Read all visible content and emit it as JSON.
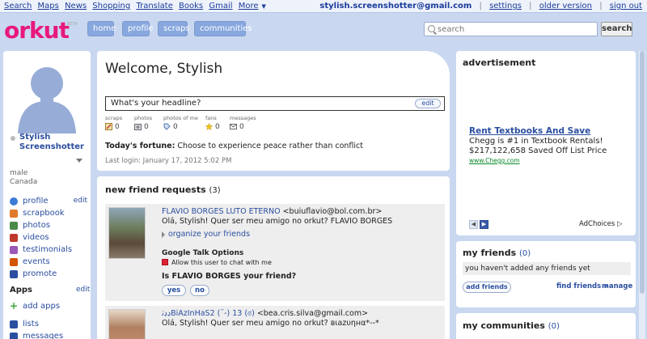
{
  "gbar": {
    "links": [
      "Search",
      "Maps",
      "News",
      "Shopping",
      "Translate",
      "Books",
      "Gmail",
      "More"
    ],
    "user": "stylish.screenshotter@gmail.com",
    "settings": "settings",
    "older_version": "older version",
    "sign_out": "sign out"
  },
  "header": {
    "logo": "orkut",
    "logo_sub": "BETA",
    "nav": [
      "home",
      "profile",
      "scraps",
      "communities"
    ],
    "search_placeholder": "search",
    "search_button": "search"
  },
  "profile": {
    "name_line1": "Stylish",
    "name_line2": "Screenshotter",
    "gender": "male",
    "country": "Canada",
    "edit": "edit",
    "menu": [
      {
        "label": "profile",
        "icon": "person-icon",
        "color": "#3a7bd5"
      },
      {
        "label": "scrapbook",
        "icon": "scrapbook-icon",
        "color": "#e07a2a"
      },
      {
        "label": "photos",
        "icon": "photos-icon",
        "color": "#4a8a4a"
      },
      {
        "label": "videos",
        "icon": "videos-icon",
        "color": "#c0392b"
      },
      {
        "label": "testimonials",
        "icon": "testimonials-icon",
        "color": "#9b59b6"
      },
      {
        "label": "events",
        "icon": "events-icon",
        "color": "#d35400"
      },
      {
        "label": "promote",
        "icon": "promote-icon",
        "color": "#2a4ea0"
      }
    ],
    "apps_heading": "Apps",
    "apps_edit": "edit",
    "apps_menu": [
      {
        "label": "add apps",
        "icon": "plus-icon",
        "color": "#3aa53a"
      }
    ],
    "extra_menu": [
      {
        "label": "lists",
        "icon": "lists-icon",
        "color": "#2a4ea0"
      },
      {
        "label": "messages",
        "icon": "messages-icon",
        "color": "#2a4ea0"
      }
    ]
  },
  "welcome": {
    "title": "Welcome, Stylish",
    "headline_placeholder": "What's your headline?",
    "edit": "edit",
    "stats": [
      {
        "label": "scraps",
        "value": "0",
        "icon": "scraps-icon"
      },
      {
        "label": "photos",
        "value": "0",
        "icon": "photos-icon"
      },
      {
        "label": "photos of me",
        "value": "0",
        "icon": "tag-icon"
      },
      {
        "label": "fans",
        "value": "0",
        "icon": "star-icon"
      },
      {
        "label": "messages",
        "value": "0",
        "icon": "envelope-icon"
      }
    ],
    "fortune_label": "Today's fortune:",
    "fortune_text": " Choose to experience peace rather than conflict",
    "last_login": "Last login: January 17, 2012 5:02 PM"
  },
  "friend_requests": {
    "heading": "new friend requests",
    "count": "(3)",
    "items": [
      {
        "name": "FLAVIO BORGES LUTO ETERNO",
        "email": " <buiuflavio@bol.com.br>",
        "message": "Olá, Stylish! Quer ser meu amigo no orkut? FLAVIO BORGES",
        "organize": "organize your friends",
        "gtalk_heading": "Google Talk Options",
        "allow_chat": "Allow this user to chat with me",
        "question": "Is FLAVIO BORGES your friend?",
        "yes": "yes",
        "no": "no"
      },
      {
        "name": "ڍڍﭠBiAzInHaS2 (¯-) 13 (ಠ)",
        "email": " <bea.cris.silva@gmail.com>",
        "message": "Olá, Stylish! Quer ser meu amigo no orkut? вιаzυηнα*--*"
      }
    ]
  },
  "advertisement": {
    "heading": "advertisement",
    "title": "Rent Textbooks And Save",
    "line1": "Chegg is #1 in Textbook Rentals!",
    "line2": "$217,122,658 Saved Off List Price",
    "url": "www.Chegg.com",
    "adchoices": "AdChoices ▷"
  },
  "my_friends": {
    "heading": "my friends",
    "count": "(0)",
    "empty": "you haven't added any friends yet",
    "add": "add friends",
    "find": "find friends »",
    "manage": "manage"
  },
  "my_communities": {
    "heading": "my communities",
    "count": "(0)"
  }
}
